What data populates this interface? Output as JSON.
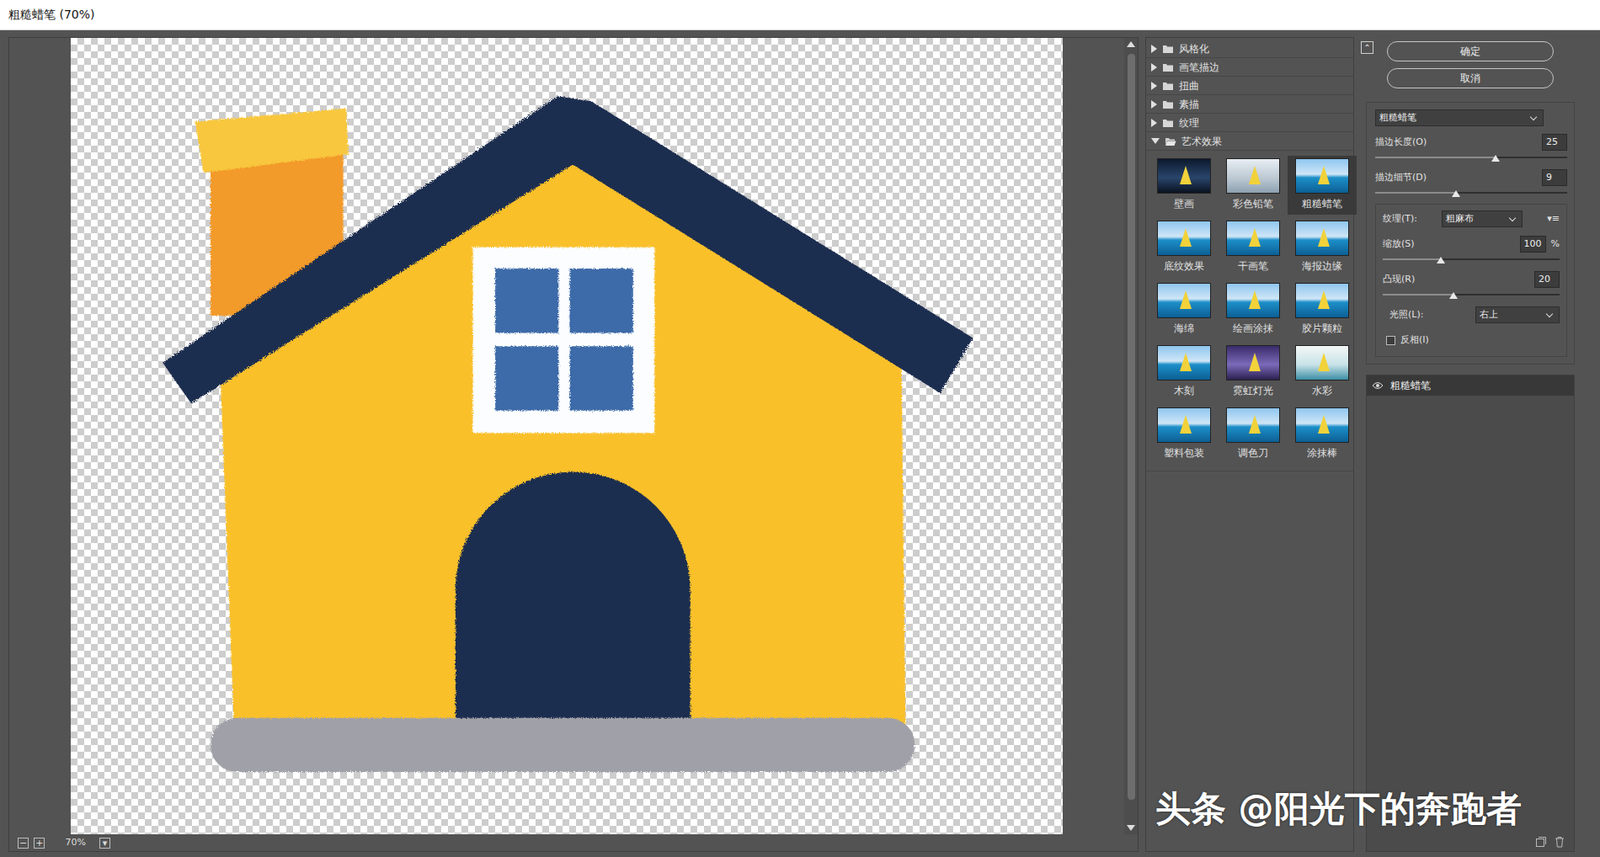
{
  "window": {
    "title": "粗糙蜡笔 (70%)"
  },
  "preview": {
    "zoom_out": "−",
    "zoom_in": "+",
    "zoom": "70%",
    "zoom_arrow": "▾"
  },
  "categories": [
    {
      "label": "风格化",
      "expanded": false
    },
    {
      "label": "画笔描边",
      "expanded": false
    },
    {
      "label": "扭曲",
      "expanded": false
    },
    {
      "label": "素描",
      "expanded": false
    },
    {
      "label": "纹理",
      "expanded": false
    },
    {
      "label": "艺术效果",
      "expanded": true
    }
  ],
  "filters": [
    {
      "label": "壁画",
      "selected": false
    },
    {
      "label": "彩色铅笔",
      "selected": false
    },
    {
      "label": "粗糙蜡笔",
      "selected": true
    },
    {
      "label": "底纹效果",
      "selected": false
    },
    {
      "label": "干画笔",
      "selected": false
    },
    {
      "label": "海报边缘",
      "selected": false
    },
    {
      "label": "海绵",
      "selected": false
    },
    {
      "label": "绘画涂抹",
      "selected": false
    },
    {
      "label": "胶片颗粒",
      "selected": false
    },
    {
      "label": "木刻",
      "selected": false
    },
    {
      "label": "霓虹灯光",
      "selected": false
    },
    {
      "label": "水彩",
      "selected": false
    },
    {
      "label": "塑料包装",
      "selected": false
    },
    {
      "label": "调色刀",
      "selected": false
    },
    {
      "label": "涂抹棒",
      "selected": false
    }
  ],
  "actions": {
    "collapse": "⌃",
    "ok": "确定",
    "cancel": "取消"
  },
  "filter_select": "粗糙蜡笔",
  "params": [
    {
      "kind": "slider",
      "label": "描边长度(O)",
      "value": "25",
      "level": 0.625
    },
    {
      "kind": "slider",
      "label": "描边细节(D)",
      "value": "9",
      "level": 0.42
    }
  ],
  "texture": {
    "label": "纹理(T):",
    "value": "粗麻布",
    "menu": "▾≡",
    "params": [
      {
        "kind": "slider",
        "label": "缩放(S)",
        "value": "100",
        "unit": "%",
        "level": 0.33
      },
      {
        "kind": "slider",
        "label": "凸现(R)",
        "value": "20",
        "level": 0.4
      },
      {
        "kind": "select",
        "label": "光照(L):",
        "value": "右上"
      },
      {
        "kind": "checkbox",
        "label": "反相(I)",
        "checked": false
      }
    ]
  },
  "layers": [
    {
      "label": "粗糙蜡笔",
      "visible": true,
      "selected": true
    }
  ],
  "watermark": "头条 @阳光下的奔跑者"
}
